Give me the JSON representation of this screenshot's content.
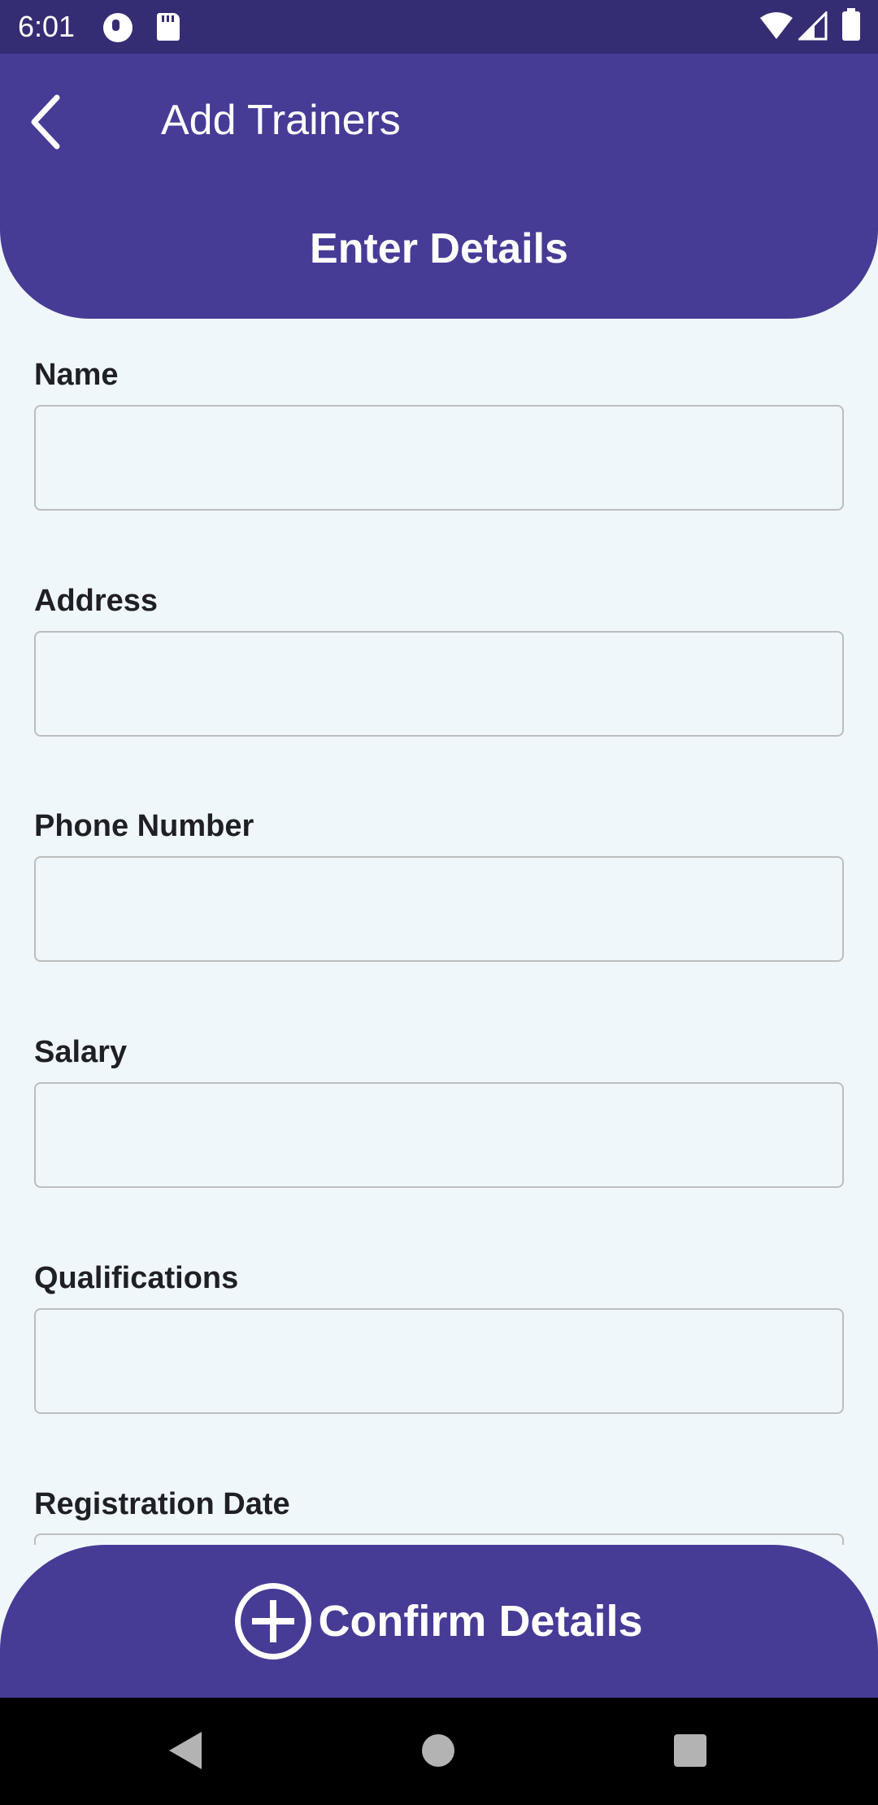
{
  "status_bar": {
    "time": "6:01",
    "icons": [
      "app-notification-icon",
      "sd-card-icon",
      "wifi-icon",
      "cellular-signal-icon",
      "battery-icon"
    ]
  },
  "header": {
    "title": "Add Trainers",
    "back_icon": "chevron-left-icon",
    "subtitle": "Enter Details",
    "color": "#463c96"
  },
  "form": {
    "fields": [
      {
        "label": "Name",
        "value": ""
      },
      {
        "label": "Address",
        "value": ""
      },
      {
        "label": "Phone Number",
        "value": ""
      },
      {
        "label": "Salary",
        "value": ""
      },
      {
        "label": "Qualifications",
        "value": ""
      },
      {
        "label": "Registration Date",
        "value": ""
      }
    ]
  },
  "confirm_button": {
    "label": "Confirm Details",
    "icon": "add-circle-icon"
  },
  "nav_bar": {
    "icons": [
      "nav-back-icon",
      "nav-home-icon",
      "nav-recents-icon"
    ]
  },
  "colors": {
    "primary": "#463c96",
    "status_bar": "#352d73",
    "background": "#f0f7fb",
    "input_border": "#bdbdbd"
  }
}
